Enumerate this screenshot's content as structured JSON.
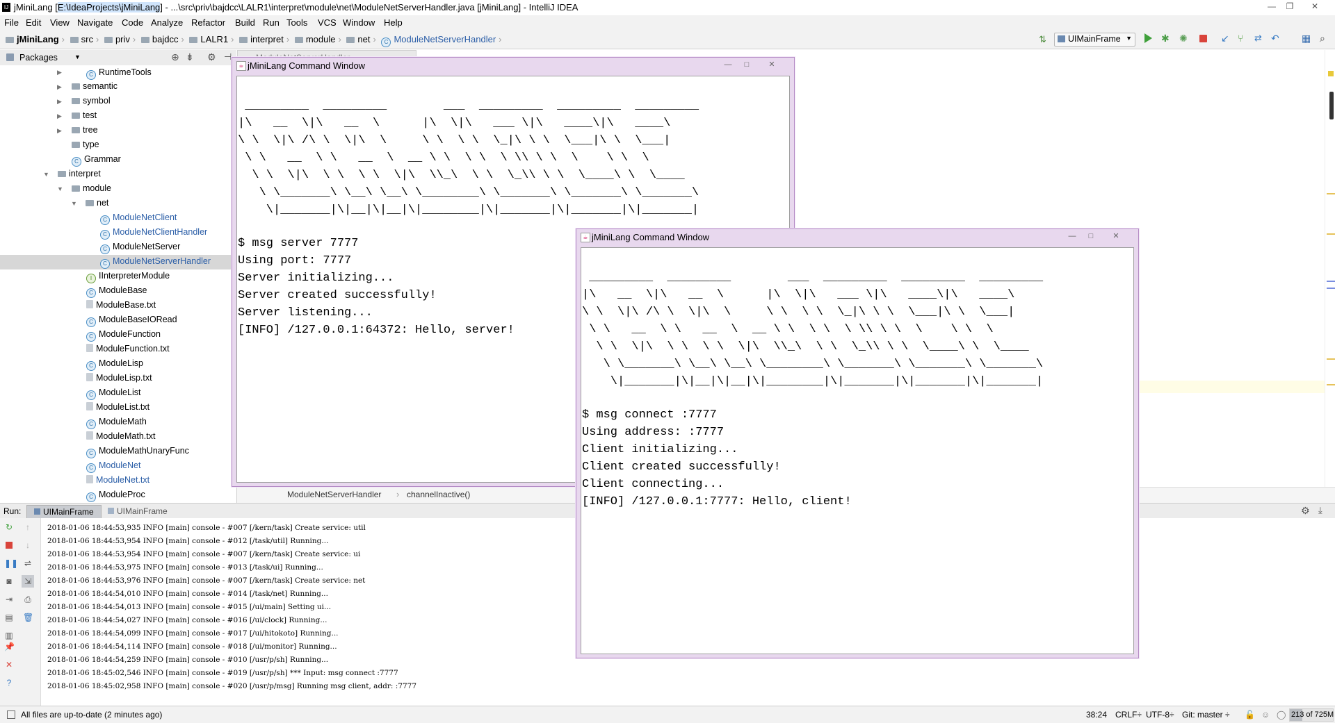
{
  "window": {
    "title_prefix": "jMiniLang [",
    "title_highlight": "E:\\IdeaProjects\\jMiniLang",
    "title_suffix": "] - ...\\src\\priv\\bajdcc\\LALR1\\interpret\\module\\net\\ModuleNetServerHandler.java [jMiniLang] - IntelliJ IDEA"
  },
  "menu": [
    "File",
    "Edit",
    "View",
    "Navigate",
    "Code",
    "Analyze",
    "Refactor",
    "Build",
    "Run",
    "Tools",
    "VCS",
    "Window",
    "Help"
  ],
  "breadcrumb": [
    "jMiniLang",
    "src",
    "priv",
    "bajdcc",
    "LALR1",
    "interpret",
    "module",
    "net",
    "ModuleNetServerHandler"
  ],
  "run_config": "UIMainFrame",
  "packages_label": "Packages",
  "editor_tab_label": "ModuleNetServerHandler",
  "tree": [
    {
      "label": "RuntimeTools",
      "kind": "class"
    },
    {
      "label": "semantic",
      "kind": "folder"
    },
    {
      "label": "symbol",
      "kind": "folder"
    },
    {
      "label": "test",
      "kind": "folder"
    },
    {
      "label": "tree",
      "kind": "folder"
    },
    {
      "label": "type",
      "kind": "folder"
    },
    {
      "label": "Grammar",
      "kind": "class"
    },
    {
      "label": "interpret",
      "kind": "folder"
    },
    {
      "label": "module",
      "kind": "folder"
    },
    {
      "label": "net",
      "kind": "folder"
    },
    {
      "label": "ModuleNetClient",
      "kind": "class"
    },
    {
      "label": "ModuleNetClientHandler",
      "kind": "class"
    },
    {
      "label": "ModuleNetServer",
      "kind": "class"
    },
    {
      "label": "ModuleNetServerHandler",
      "kind": "class"
    },
    {
      "label": "IInterpreterModule",
      "kind": "interface"
    },
    {
      "label": "ModuleBase",
      "kind": "class"
    },
    {
      "label": "ModuleBase.txt",
      "kind": "file"
    },
    {
      "label": "ModuleBaseIORead",
      "kind": "class"
    },
    {
      "label": "ModuleFunction",
      "kind": "class"
    },
    {
      "label": "ModuleFunction.txt",
      "kind": "file"
    },
    {
      "label": "ModuleLisp",
      "kind": "class"
    },
    {
      "label": "ModuleLisp.txt",
      "kind": "file"
    },
    {
      "label": "ModuleList",
      "kind": "class"
    },
    {
      "label": "ModuleList.txt",
      "kind": "file"
    },
    {
      "label": "ModuleMath",
      "kind": "class"
    },
    {
      "label": "ModuleMath.txt",
      "kind": "file"
    },
    {
      "label": "ModuleMathUnaryFunc",
      "kind": "class"
    },
    {
      "label": "ModuleNet",
      "kind": "class"
    },
    {
      "label": "ModuleNet.txt",
      "kind": "file"
    },
    {
      "label": "ModuleProc",
      "kind": "class"
    }
  ],
  "editor_breadcrumb": [
    "ModuleNetServerHandler",
    "channelInactive()"
  ],
  "run": {
    "label": "Run:",
    "tabs": [
      "UIMainFrame",
      "UIMainFrame"
    ],
    "log": [
      "2018-01-06 18:44:53,935 INFO  [main] console  - #007 [/kern/task] Create service: util",
      "2018-01-06 18:44:53,954 INFO  [main] console  - #012 [/task/util] Running...",
      "2018-01-06 18:44:53,954 INFO  [main] console  - #007 [/kern/task] Create service: ui",
      "2018-01-06 18:44:53,975 INFO  [main] console  - #013 [/task/ui] Running...",
      "2018-01-06 18:44:53,976 INFO  [main] console  - #007 [/kern/task] Create service: net",
      "2018-01-06 18:44:54,010 INFO  [main] console  - #014 [/task/net] Running...",
      "2018-01-06 18:44:54,013 INFO  [main] console  - #015 [/ui/main] Setting ui...",
      "2018-01-06 18:44:54,027 INFO  [main] console  - #016 [/ui/clock] Running...",
      "2018-01-06 18:44:54,099 INFO  [main] console  - #017 [/ui/hitokoto] Running...",
      "2018-01-06 18:44:54,114 INFO  [main] console  - #018 [/ui/monitor] Running...",
      "2018-01-06 18:44:54,259 INFO  [main] console  - #010 [/usr/p/sh] Running...",
      "2018-01-06 18:45:02,546 INFO  [main] console  - #019 [/usr/p/sh] *** Input: msg connect :7777",
      "2018-01-06 18:45:02,958 INFO  [main] console  - #020 [/usr/p/msg] Running msg client, addr: :7777"
    ]
  },
  "cmd_server": {
    "title": "jMiniLang Command Window",
    "banner": " _________  _________        ___  _________  _________  _________\n|\\   __  \\|\\   __  \\      |\\  \\|\\   ___ \\|\\   ____\\|\\   ____\\\n\\ \\  \\|\\ /\\ \\  \\|\\  \\     \\ \\  \\ \\  \\_|\\ \\ \\  \\___|\\ \\  \\___|\n \\ \\   __  \\ \\   __  \\  __ \\ \\  \\ \\  \\ \\\\ \\ \\  \\    \\ \\  \\\n  \\ \\  \\|\\  \\ \\  \\ \\  \\|\\  \\\\_\\  \\ \\  \\_\\\\ \\ \\  \\____\\ \\  \\____\n   \\ \\_______\\ \\__\\ \\__\\ \\________\\ \\_______\\ \\_______\\ \\_______\\\n    \\|_______|\\|__|\\|__|\\|________|\\|_______|\\|_______|\\|_______|",
    "lines": [
      "$ msg server 7777",
      "Using port: 7777",
      "Server initializing...",
      "Server created successfully!",
      "Server listening...",
      "[INFO] /127.0.0.1:64372: Hello, server!"
    ]
  },
  "cmd_client": {
    "title": "jMiniLang Command Window",
    "banner": " _________  _________        ___  _________  _________  _________\n|\\   __  \\|\\   __  \\      |\\  \\|\\   ___ \\|\\   ____\\|\\   ____\\\n\\ \\  \\|\\ /\\ \\  \\|\\  \\     \\ \\  \\ \\  \\_|\\ \\ \\  \\___|\\ \\  \\___|\n \\ \\   __  \\ \\   __  \\  __ \\ \\  \\ \\  \\ \\\\ \\ \\  \\    \\ \\  \\\n  \\ \\  \\|\\  \\ \\  \\ \\  \\|\\  \\\\_\\  \\ \\  \\_\\\\ \\ \\  \\____\\ \\  \\____\n   \\ \\_______\\ \\__\\ \\__\\ \\________\\ \\_______\\ \\_______\\ \\_______\\\n    \\|_______|\\|__|\\|__|\\|________|\\|_______|\\|_______|\\|_______|",
    "lines": [
      "$ msg connect :7777",
      "Using address: :7777",
      "Client initializing...",
      "Client created successfully!",
      "Client connecting...",
      "[INFO] /127.0.0.1:7777: Hello, client!"
    ]
  },
  "status": {
    "message": "All files are up-to-date (2 minutes ago)",
    "position": "38:24",
    "line_sep": "CRLF÷",
    "encoding": "UTF-8÷",
    "git": "Git: master ÷",
    "memory": "213 of 725M"
  }
}
